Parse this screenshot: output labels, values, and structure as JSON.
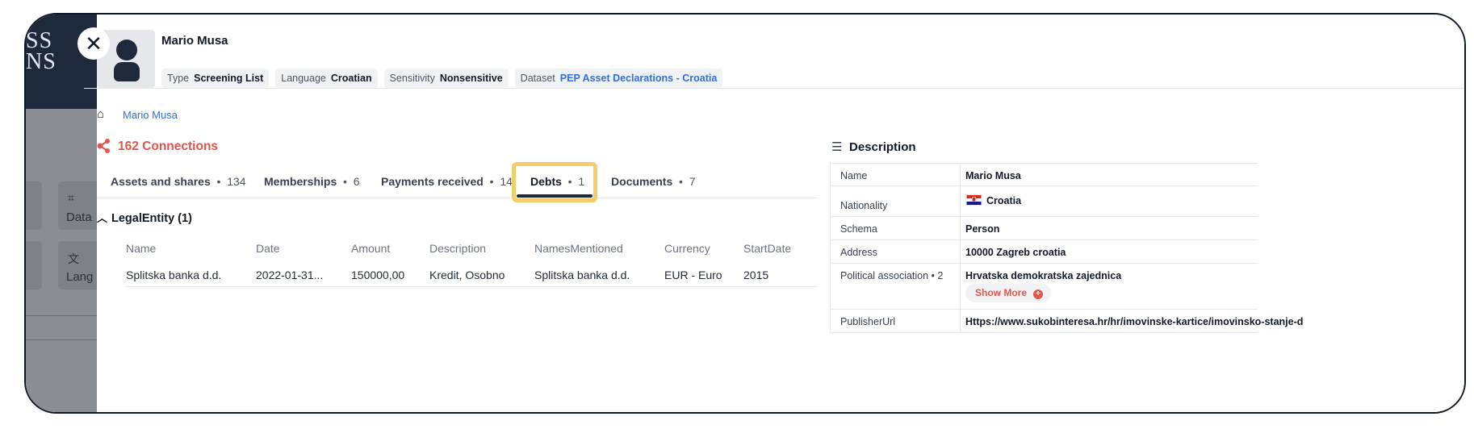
{
  "background": {
    "logo_lines": [
      "SS",
      "NS"
    ],
    "card_labels": [
      "Data",
      "Lang"
    ]
  },
  "entity": {
    "name": "Mario Musa",
    "tags": [
      {
        "key": "Type",
        "value": "Screening List"
      },
      {
        "key": "Language",
        "value": "Croatian"
      },
      {
        "key": "Sensitivity",
        "value": "Nonsensitive"
      },
      {
        "key": "Dataset",
        "value": "PEP Asset Declarations - Croatia"
      }
    ]
  },
  "breadcrumb": {
    "current": "Mario Musa"
  },
  "connections": {
    "label": "162 Connections"
  },
  "tabs": [
    {
      "label": "Assets and shares",
      "count": "134"
    },
    {
      "label": "Memberships",
      "count": "6"
    },
    {
      "label": "Payments received",
      "count": "14"
    },
    {
      "label": "Debts",
      "count": "1",
      "active": true
    },
    {
      "label": "Documents",
      "count": "7"
    }
  ],
  "section": {
    "title": "LegalEntity (1)"
  },
  "table": {
    "headers": [
      "Name",
      "Date",
      "Amount",
      "Description",
      "NamesMentioned",
      "Currency",
      "StartDate"
    ],
    "rows": [
      [
        "Splitska banka d.d.",
        "2022-01-31...",
        "150000,00",
        "Kredit, Osobno",
        "Splitska banka d.d.",
        "EUR - Euro",
        "2015"
      ]
    ]
  },
  "description": {
    "title": "Description",
    "rows": [
      {
        "key": "Name",
        "value": "Mario Musa"
      },
      {
        "key": "Nationality",
        "value": "Croatia"
      },
      {
        "key": "Schema",
        "value": "Person"
      },
      {
        "key": "Address",
        "value": "10000 Zagreb croatia"
      },
      {
        "key": "Political association • 2",
        "value": "Hrvatska demokratska zajednica",
        "more": "Show More"
      },
      {
        "key": "PublisherUrl",
        "value": "Https://www.sukobinteresa.hr/hr/imovinske-kartice/imovinsko-stanje-d"
      }
    ]
  },
  "colors": {
    "accent_red": "#e0564b",
    "link_blue": "#2f6fde",
    "highlight": "#f2cd6a",
    "dark": "#1e293b"
  },
  "icons": [
    "close-icon",
    "person-icon",
    "home-icon",
    "share-icon",
    "chevron-up-icon",
    "list-icon",
    "croatia-flag-icon",
    "plus-circle-icon"
  ]
}
